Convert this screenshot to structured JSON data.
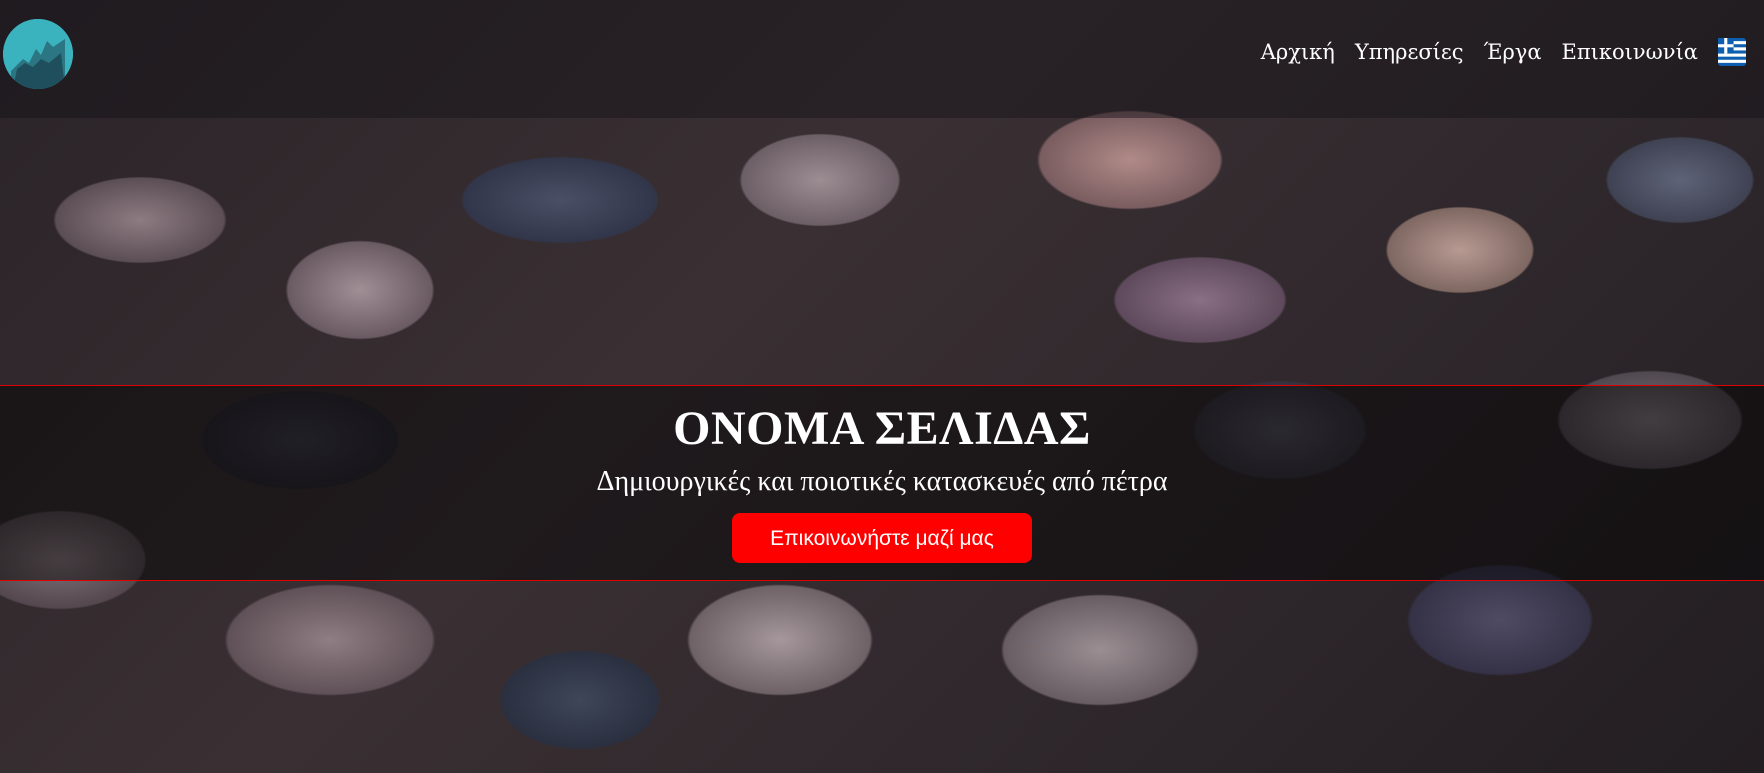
{
  "nav": {
    "links": [
      "Αρχική",
      "Υπηρεσίες",
      "Έργα",
      "Επικοινωνία"
    ],
    "language_icon": "greek-flag-icon",
    "logo_icon": "mountain-logo-icon"
  },
  "hero": {
    "title": "ΟΝΟΜΑ ΣΕΛΙΔΑΣ",
    "tagline": "Δημιουργικές και ποιοτικές κατασκευές από πέτρα",
    "cta_label": "Επικοινωνήστε μαζί μας"
  },
  "colors": {
    "accent": "#ff0000",
    "logo": "#3bb3bf",
    "text": "#ffffff"
  }
}
